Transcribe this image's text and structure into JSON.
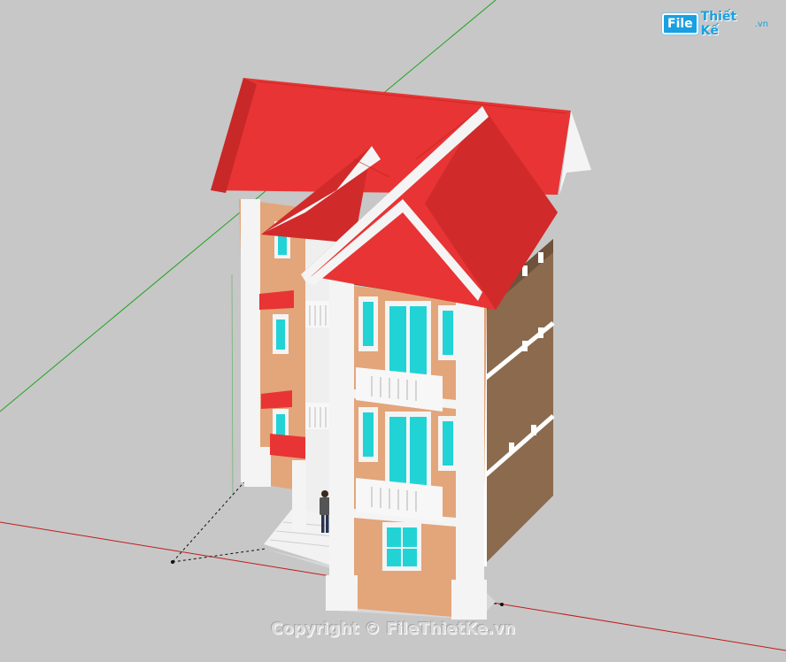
{
  "watermark": {
    "logo_box": "File",
    "logo_text": "Thiết Kế",
    "logo_domain": ".vn",
    "copyright": "Copyright © FileThietKe.vn"
  },
  "scene": {
    "background_color": "#c7c7c7",
    "roof_color": "#e83434",
    "wall_color": "#e3a57a",
    "side_wall_color": "#8b6a4e",
    "trim_color": "#ffffff",
    "glass_color": "#22d3d6",
    "axis_green": "#1fa31f",
    "axis_red": "#c21b1b"
  }
}
